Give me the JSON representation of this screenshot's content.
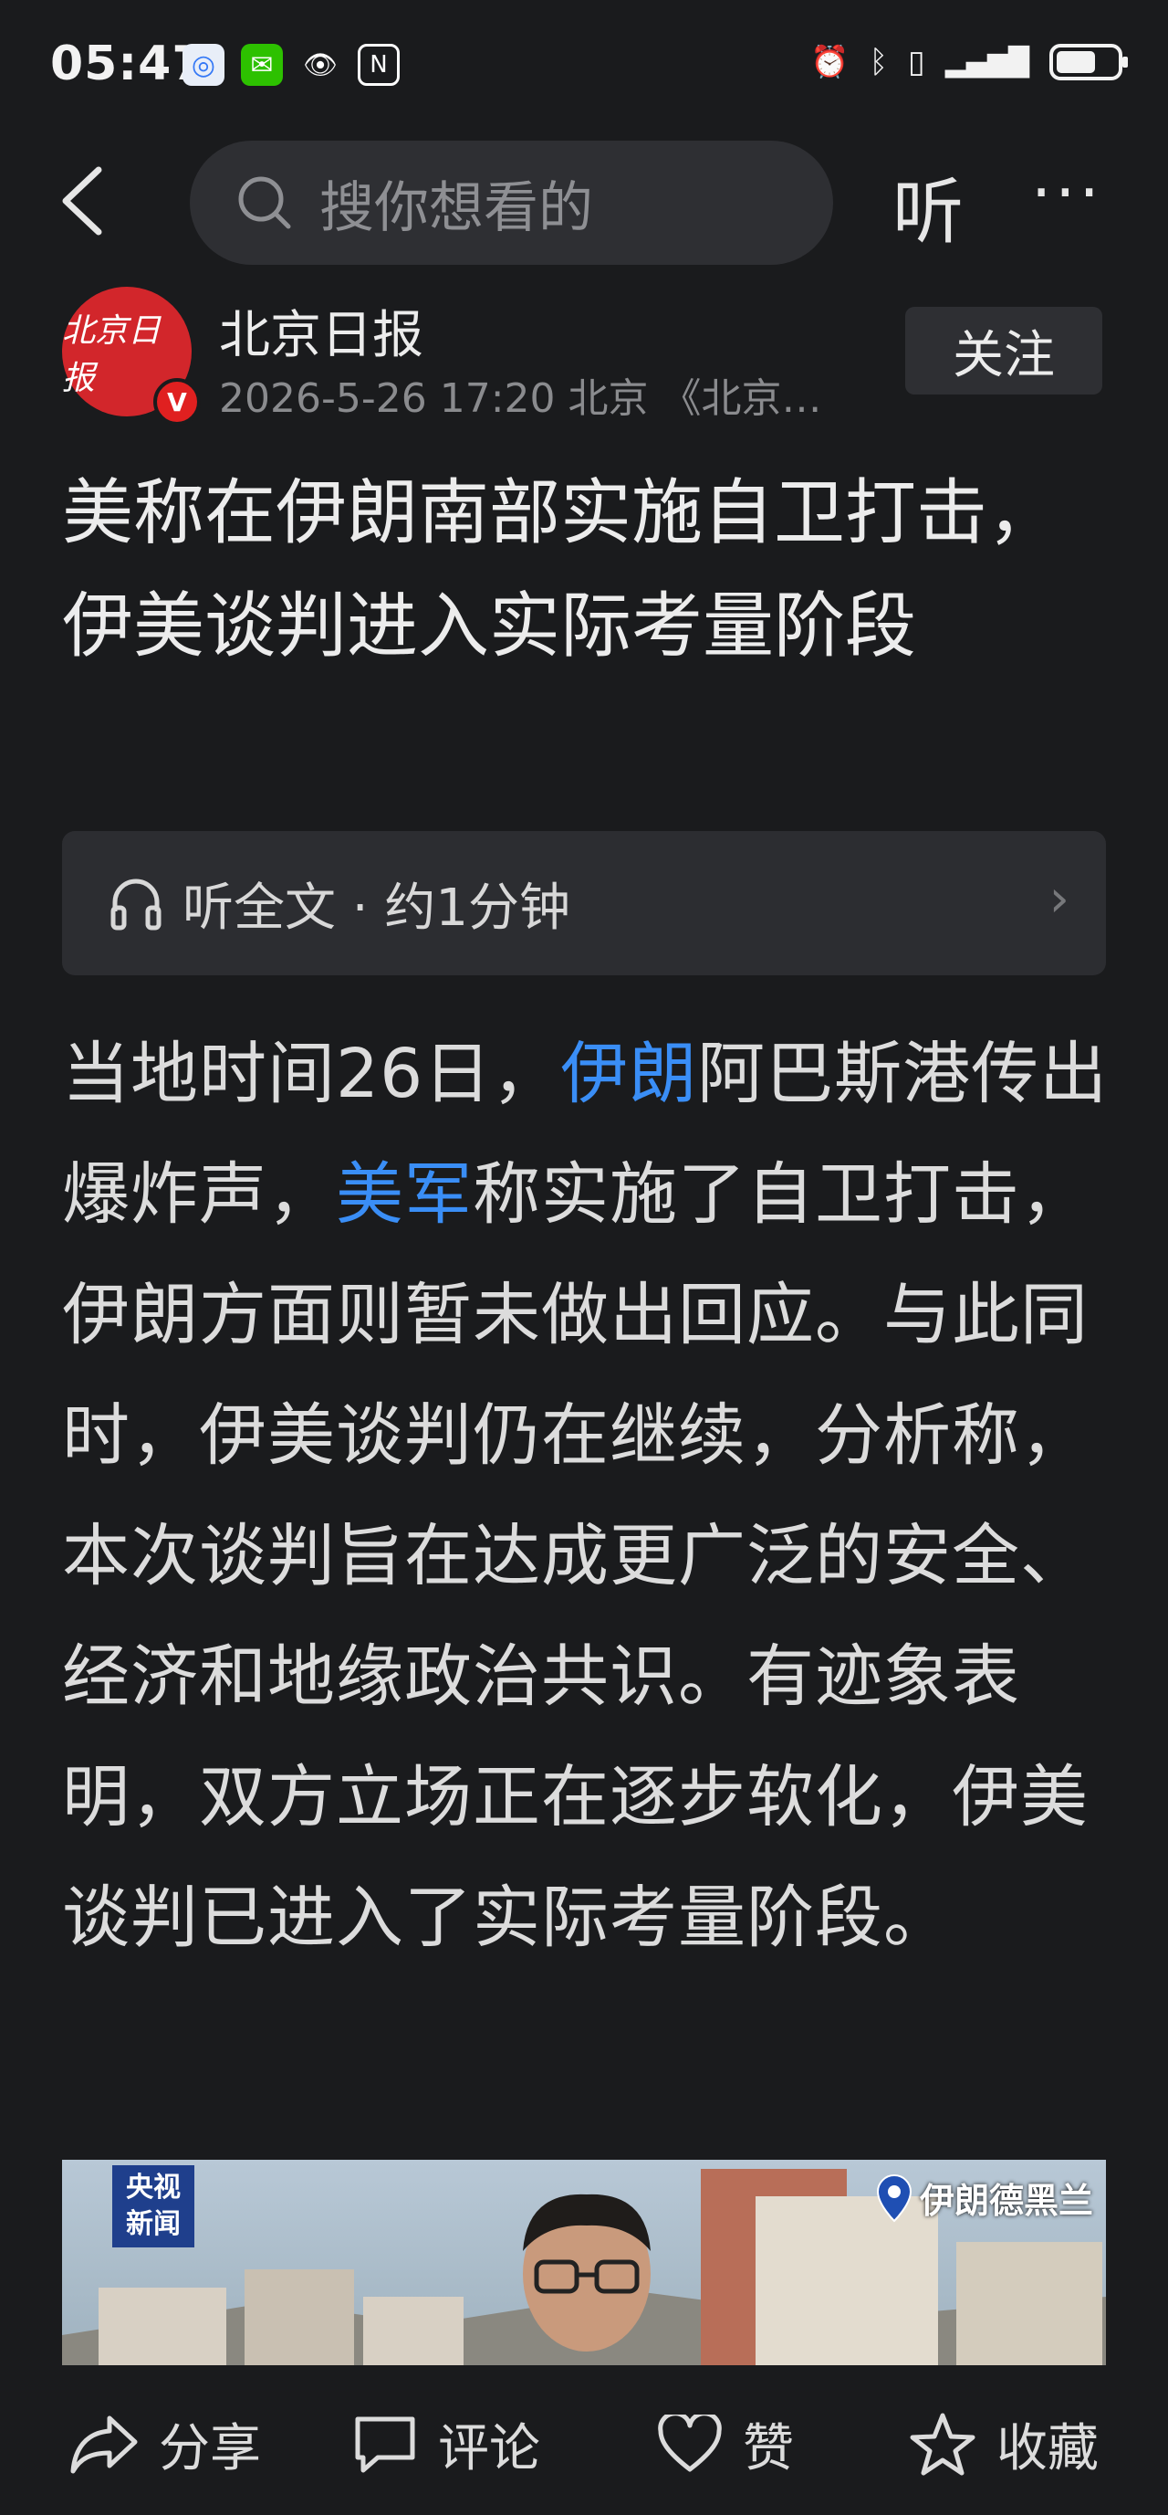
{
  "status_bar": {
    "time": "05:47",
    "battery_level": 0.65
  },
  "nav": {
    "search_placeholder": "搜你想看的",
    "listen_label": "听",
    "more_label": "···"
  },
  "author": {
    "logo_text": "北京日报",
    "name": "北京日报",
    "meta": "2026-5-26  17:20  北京  《北京…",
    "follow_label": "关注",
    "verified_mark": "V"
  },
  "article": {
    "title": "美称在伊朗南部实施自卫打击，伊美谈判进入实际考量阶段",
    "listen_full": "听全文 · 约1分钟",
    "body_parts": {
      "p1": "当地时间26日，",
      "link1": "伊朗",
      "p2": "阿巴斯港传出爆炸声，",
      "link2": "美军",
      "p3": "称实施了自卫打击，伊朗方面则暂未做出回应。与此同时，伊美谈判仍在继续，分析称，本次谈判旨在达成更广泛的安全、经济和地缘政治共识。有迹象表明，双方立场正在逐步软化，伊美谈判已进入了实际考量阶段。"
    }
  },
  "image": {
    "cctv_logo": [
      "央视",
      "新闻"
    ],
    "location": "伊朗德黑兰"
  },
  "bottom_bar": {
    "share": "分享",
    "comment": "评论",
    "like": "赞",
    "favorite": "收藏"
  },
  "colors": {
    "background": "#1a1b1d",
    "link": "#3a8ef6",
    "avatar": "#d2262b"
  }
}
